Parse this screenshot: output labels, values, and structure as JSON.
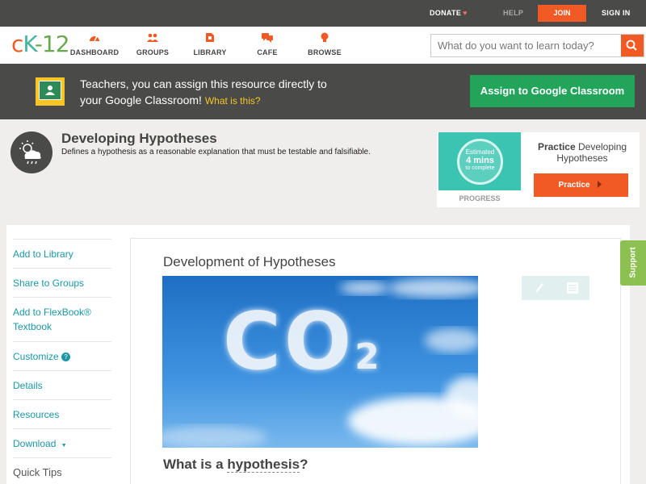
{
  "topbar": {
    "donate": "DONATE",
    "help": "HELP",
    "join": "JOIN",
    "signin": "SIGN IN"
  },
  "logo": {
    "c": "c",
    "k": "K",
    "n": "-12"
  },
  "nav": [
    {
      "label": "DASHBOARD",
      "icon": "dashboard-icon"
    },
    {
      "label": "GROUPS",
      "icon": "groups-icon"
    },
    {
      "label": "LIBRARY",
      "icon": "library-icon"
    },
    {
      "label": "CAFE",
      "icon": "cafe-icon"
    },
    {
      "label": "BROWSE",
      "icon": "browse-icon"
    }
  ],
  "search": {
    "placeholder": "What do you want to learn today?"
  },
  "banner": {
    "line1": "Teachers, you can assign this resource directly to",
    "line2": "your Google Classroom!",
    "what": "What is this?",
    "assign": "Assign to Google Classroom"
  },
  "concept": {
    "title": "Developing Hypotheses",
    "description": "Defines a hypothesis as a reasonable explanation that must be testable and falsifiable."
  },
  "practice": {
    "estimated": "Estimated",
    "mins": "4 mins",
    "complete": "to complete",
    "progress": "PROGRESS",
    "title_bold": "Practice",
    "title_rest": "Developing Hypotheses",
    "button": "Practice"
  },
  "sidebar": {
    "items": [
      {
        "label": "Add to Library"
      },
      {
        "label": "Share to Groups"
      },
      {
        "label": "Add to FlexBook® Textbook"
      },
      {
        "label": "Customize"
      },
      {
        "label": "Details"
      },
      {
        "label": "Resources"
      },
      {
        "label": "Download"
      }
    ],
    "help_mark": "?",
    "download_caret": "▼",
    "quick_tips": "Quick Tips"
  },
  "lesson": {
    "title": "Development of Hypotheses",
    "heading_pre": "What is a",
    "heading_term": "hypothesis",
    "heading_post": "?",
    "hero_text": "CO",
    "hero_sub": "2"
  },
  "support": "Support",
  "colors": {
    "accent": "#f15a24",
    "teal": "#1b97a7",
    "green": "#22a55b",
    "dark": "#4a4a48"
  }
}
